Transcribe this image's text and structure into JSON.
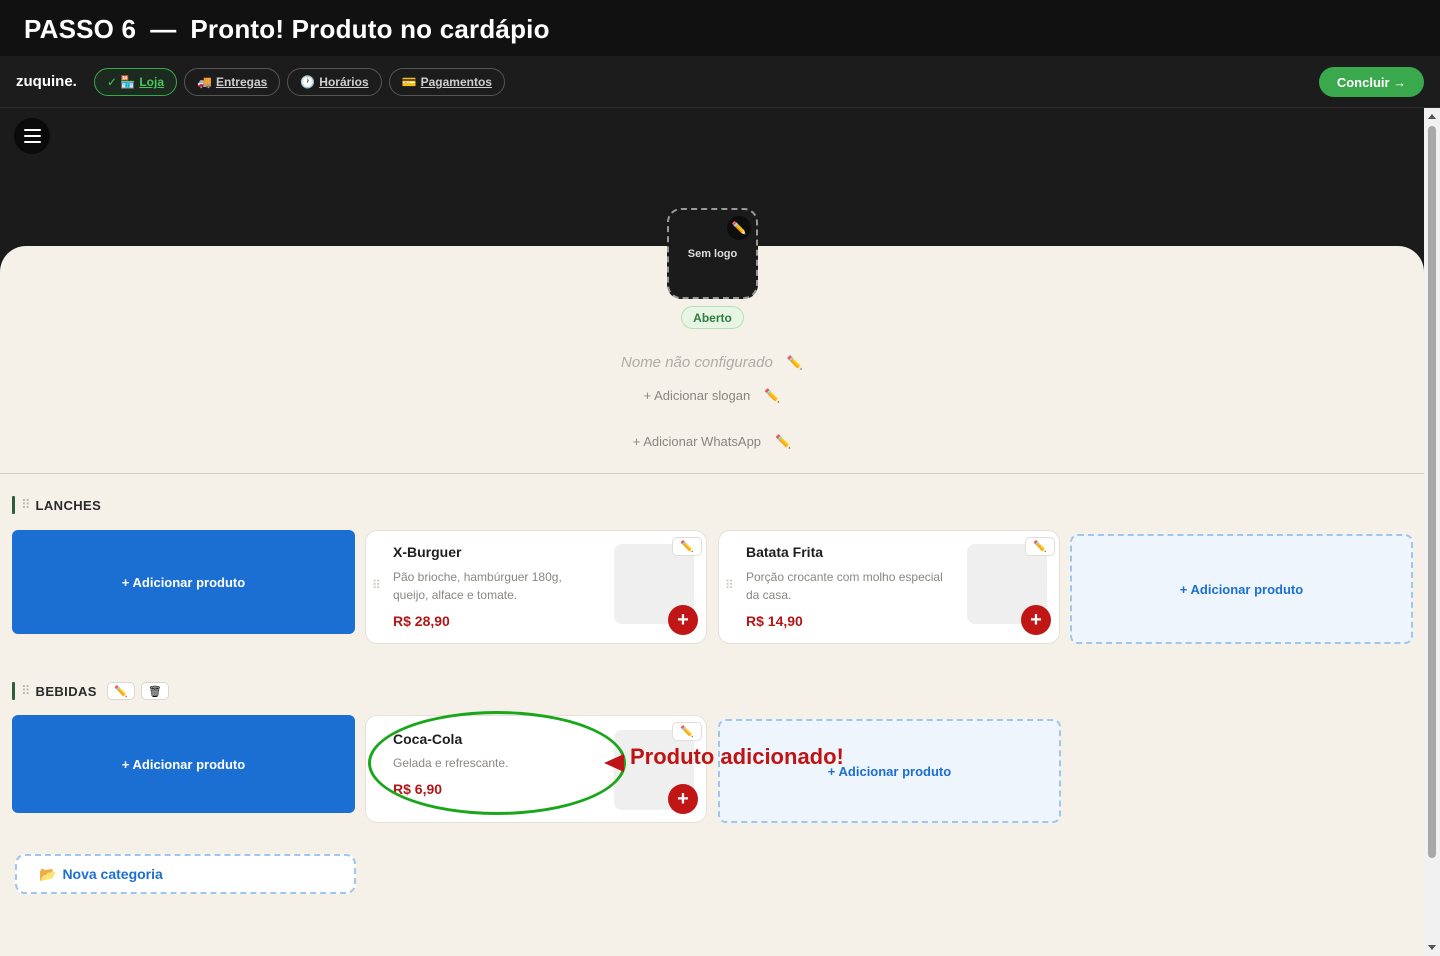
{
  "banner": {
    "step": "PASSO 6",
    "sep": "—",
    "text": "Pronto! Produto no cardápio"
  },
  "brand": "zuquine.",
  "tabs": [
    {
      "icon": "✓ 🏪",
      "label": "Loja"
    },
    {
      "icon": "🚚",
      "label": "Entregas"
    },
    {
      "icon": "🕐",
      "label": "Horários"
    },
    {
      "icon": "💳",
      "label": "Pagamentos"
    }
  ],
  "concluir": "Concluir →",
  "store": {
    "logo_text": "Sem logo",
    "status": "Aberto",
    "name_placeholder": "Nome não configurado",
    "slogan_add": "+ Adicionar slogan",
    "whatsapp_add": "+ Adicionar WhatsApp",
    "edit_glyph": "✏️"
  },
  "categories": [
    {
      "title": "LANCHES",
      "add_label": "+  Adicionar produto",
      "products": [
        {
          "name": "X-Burguer",
          "desc": "Pão brioche, hambúrguer 180g, queijo, alface e tomate.",
          "price": "R$ 28,90"
        },
        {
          "name": "Batata Frita",
          "desc": "Porção crocante com molho especial da casa.",
          "price": "R$ 14,90"
        }
      ]
    },
    {
      "title": "BEBIDAS",
      "add_label": "+  Adicionar produto",
      "products": [
        {
          "name": "Coca-Cola",
          "desc": "Gelada e refrescante.",
          "price": "R$ 6,90"
        }
      ]
    }
  ],
  "new_category": {
    "icon": "📂",
    "label": "Nova categoria"
  },
  "annotation": {
    "text": "Produto adicionado!",
    "circle_color": "#1aa61a",
    "text_color": "#c01414"
  },
  "colors": {
    "accent_green": "#3aa84d",
    "primary_blue": "#1c6fd2",
    "price_red": "#b01818",
    "cream": "#f5f1e9"
  },
  "icons": [
    "menu-icon",
    "pencil-icon",
    "trash-icon",
    "plus-icon",
    "drag-grip-icon",
    "folder-icon"
  ]
}
